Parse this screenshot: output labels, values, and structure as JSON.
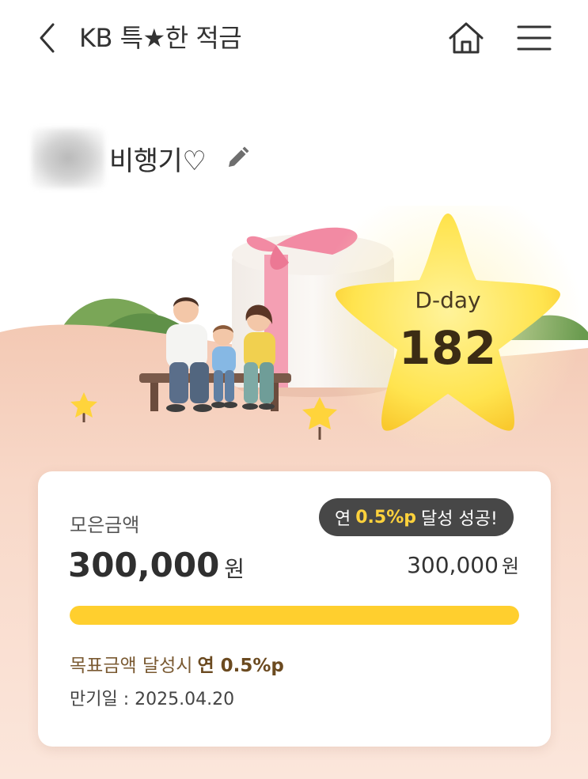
{
  "header": {
    "title": "KB 특★한 적금"
  },
  "account": {
    "name": "비행기♡"
  },
  "dday": {
    "label": "D-day",
    "value": "182"
  },
  "summary": {
    "saved_label": "모은금액",
    "saved_amount": "300,000",
    "currency_unit": "원",
    "target_amount": "300,000",
    "badge_prefix": "연",
    "badge_rate": "0.5%p",
    "badge_suffix": "달성 성공!",
    "progress_fraction": 1.0,
    "bonus_text": "목표금액 달성시",
    "bonus_rate": "연 0.5%p",
    "maturity_text": "만기일 : 2025.04.20"
  },
  "colors": {
    "accent_yellow": "#ffcf2e",
    "badge_bg": "#474747",
    "background_peach": "#f9dccd"
  },
  "icons": {
    "back": "chevron-left-icon",
    "home": "home-icon",
    "menu": "hamburger-menu-icon",
    "edit": "pencil-icon"
  }
}
